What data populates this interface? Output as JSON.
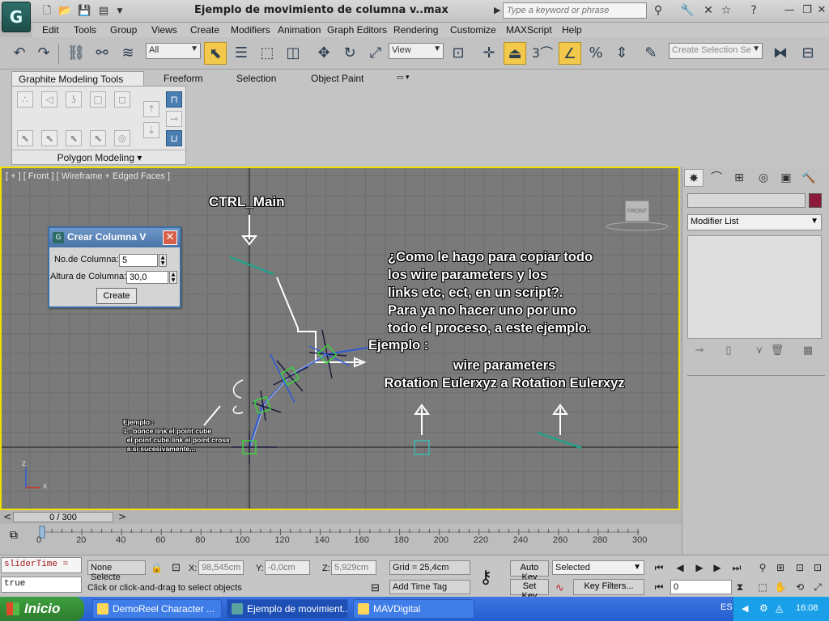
{
  "window": {
    "title": "Ejemplo de movimiento de columna v..max",
    "search_placeholder": "Type a keyword or phrase",
    "app_logo": "G"
  },
  "menu": [
    "Edit",
    "Tools",
    "Group",
    "Views",
    "Create",
    "Modifiers",
    "Animation",
    "Graph Editors",
    "Rendering",
    "Customize",
    "MAXScript",
    "Help"
  ],
  "toolbar": {
    "selection_filter": "All",
    "reference_coord": "View",
    "snap_label": "3",
    "named_selection_placeholder": "Create Selection Se"
  },
  "ribbon": {
    "tabs": [
      "Graphite Modeling Tools",
      "Freeform",
      "Selection",
      "Object Paint"
    ],
    "panel_label": "Polygon Modeling"
  },
  "viewport": {
    "label": "[ + ] [ Front ] [ Wireframe + Edged Faces ]",
    "ctrl_main": "CTRL_Main",
    "question": "¿Como le hago para copiar todo\nlos wire parameters y los\nlinks etc, ect, en un script?.\nPara ya no hacer uno por uno\ntodo el proceso, a este ejemplo.",
    "ejemplo": "Ejemplo :",
    "wire_text": "wire parameters\nRotation Eulerxyz a Rotation Eulerxyz",
    "small_note": "Ejemplo :\n1.- bonce link el point cube\n  el point cube link el point cross\n  a si sucesivamente...",
    "viewcube_label": "FRONT",
    "axis_z": "z",
    "axis_x": "x"
  },
  "dialog": {
    "title": "Crear Columna V",
    "close": "✕",
    "columns_label": "No.de Columna:",
    "columns_value": "5",
    "height_label": "Altura de Columna:",
    "height_value": "30,0",
    "create_label": "Create"
  },
  "command_panel": {
    "modifier_list": "Modifier List",
    "swatch_color": "#8b1a3a"
  },
  "time": {
    "slider": "0 / 300",
    "ticks": [
      "0",
      "20",
      "40",
      "60",
      "80",
      "100",
      "120",
      "140",
      "160",
      "180",
      "200",
      "220",
      "240",
      "260",
      "280",
      "300"
    ]
  },
  "status": {
    "script_line1": "sliderTime =",
    "script_line2": "true",
    "selection": "None Selecte",
    "x_label": "X:",
    "x_value": "98,545cm",
    "y_label": "Y:",
    "y_value": "-0,0cm",
    "z_label": "Z:",
    "z_value": "5,929cm",
    "grid": "Grid = 25,4cm",
    "prompt": "Click or click-and-drag to select objects",
    "add_time_tag": "Add Time Tag",
    "auto_key": "Auto Key",
    "set_key": "Set Key",
    "key_mode": "Selected",
    "key_filters": "Key Filters...",
    "frame": "0"
  },
  "taskbar": {
    "start": "Inicio",
    "tasks": [
      "DemoReel Character ...",
      "Ejemplo de movimient...",
      "MAVDigital"
    ],
    "lang": "ES",
    "clock": "16:08"
  }
}
